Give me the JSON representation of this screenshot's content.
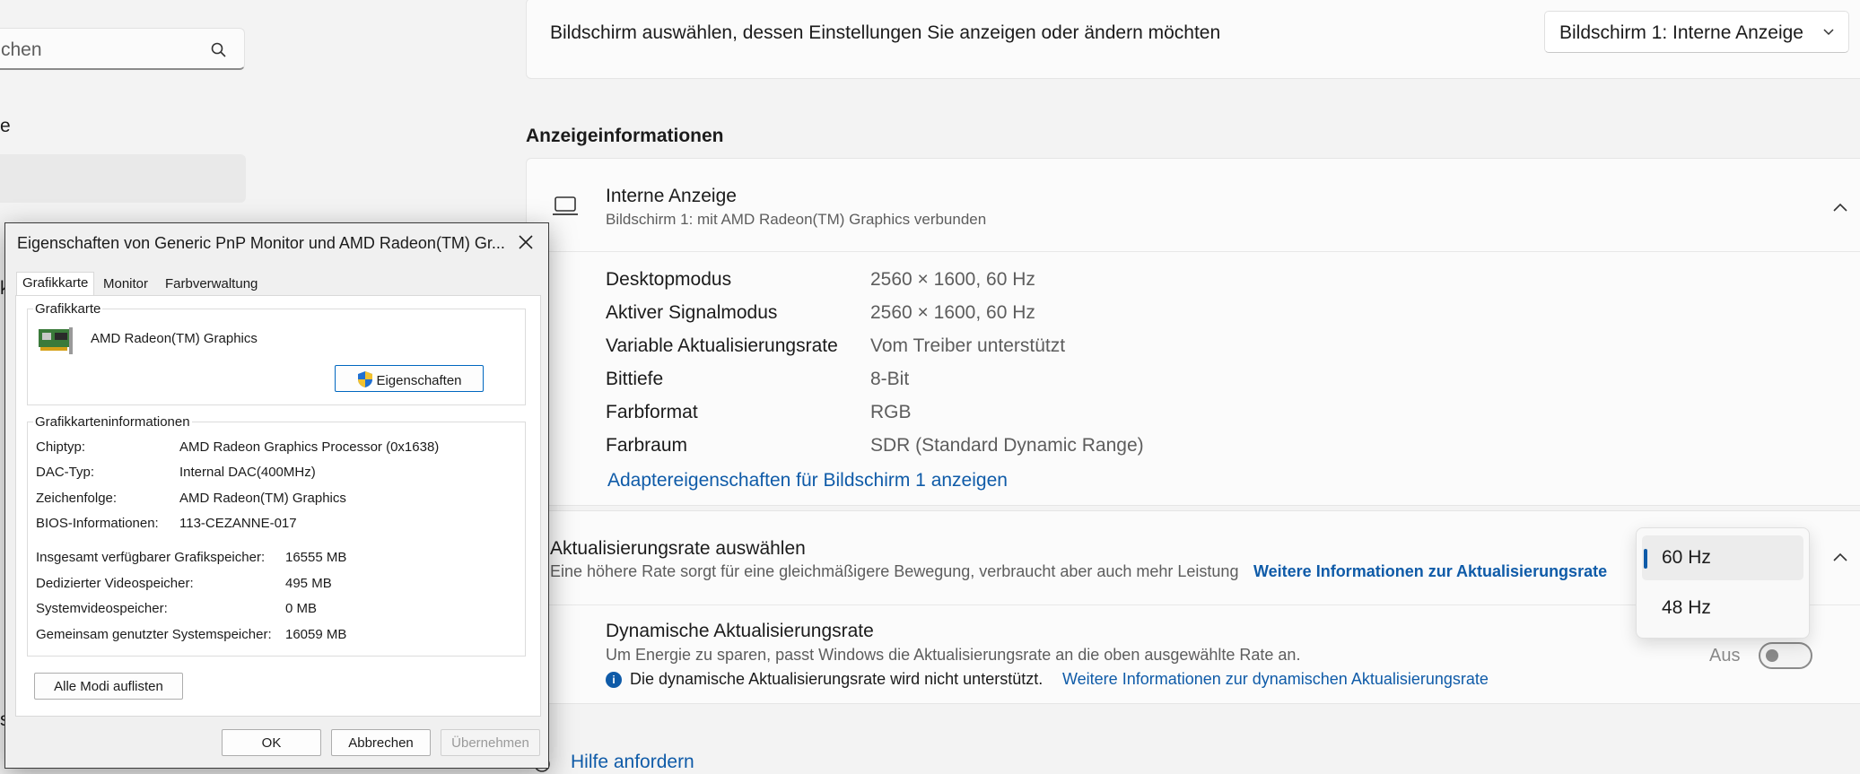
{
  "sidebar": {
    "search_text": "chen",
    "fragments": [
      "e",
      "k",
      "s"
    ]
  },
  "display_select": {
    "label": "Bildschirm auswählen, dessen Einstellungen Sie anzeigen oder ändern möchten",
    "value": "Bildschirm 1: Interne Anzeige"
  },
  "display_info": {
    "section_title": "Anzeigeinformationen",
    "name": "Interne Anzeige",
    "subtitle": "Bildschirm 1: mit AMD Radeon(TM) Graphics verbunden",
    "rows": [
      {
        "label": "Desktopmodus",
        "value": "2560 × 1600, 60 Hz"
      },
      {
        "label": "Aktiver Signalmodus",
        "value": "2560 × 1600, 60 Hz"
      },
      {
        "label": "Variable Aktualisierungsrate",
        "value": "Vom Treiber unterstützt"
      },
      {
        "label": "Bittiefe",
        "value": "8-Bit"
      },
      {
        "label": "Farbformat",
        "value": "RGB"
      },
      {
        "label": "Farbraum",
        "value": "SDR (Standard Dynamic Range)"
      }
    ],
    "adapter_link": "Adaptereigenschaften für Bildschirm 1 anzeigen"
  },
  "refresh": {
    "title": "Aktualisierungsrate auswählen",
    "desc": "Eine höhere Rate sorgt für eine gleichmäßigere Bewegung, verbraucht aber auch mehr Leistung",
    "more_link": "Weitere Informationen zur Aktualisierungsrate",
    "options": [
      "60 Hz",
      "48 Hz"
    ],
    "selected": "60 Hz",
    "dynamic_title": "Dynamische Aktualisierungsrate",
    "dynamic_desc": "Um Energie zu sparen, passt Windows die Aktualisierungsrate an die oben ausgewählte Rate an.",
    "not_supported": "Die dynamische Aktualisierungsrate wird nicht unterstützt.",
    "dynamic_link": "Weitere Informationen zur dynamischen Aktualisierungsrate",
    "toggle_state": "Aus"
  },
  "help_link": "Hilfe anfordern",
  "dialog": {
    "title": "Eigenschaften von Generic PnP Monitor und AMD Radeon(TM) Gr...",
    "tabs": [
      "Grafikkarte",
      "Monitor",
      "Farbverwaltung"
    ],
    "adapter_group_title": "Grafikkarte",
    "adapter_name": "AMD Radeon(TM) Graphics",
    "properties_button": "Eigenschaften",
    "info_group_title": "Grafikkarteninformationen",
    "info_rows": [
      {
        "label": "Chiptyp:",
        "value": "AMD Radeon Graphics Processor (0x1638)"
      },
      {
        "label": "DAC-Typ:",
        "value": "Internal DAC(400MHz)"
      },
      {
        "label": "Zeichenfolge:",
        "value": "AMD Radeon(TM) Graphics"
      },
      {
        "label": "BIOS-Informationen:",
        "value": "113-CEZANNE-017"
      }
    ],
    "memory_rows": [
      {
        "label": "Insgesamt verfügbarer Grafikspeicher:",
        "value": "16555 MB"
      },
      {
        "label": "Dedizierter Videospeicher:",
        "value": "495 MB"
      },
      {
        "label": "Systemvideospeicher:",
        "value": "0 MB"
      },
      {
        "label": "Gemeinsam genutzter Systemspeicher:",
        "value": "16059 MB"
      }
    ],
    "list_modes_button": "Alle Modi auflisten",
    "ok_button": "OK",
    "cancel_button": "Abbrechen",
    "apply_button": "Übernehmen"
  }
}
